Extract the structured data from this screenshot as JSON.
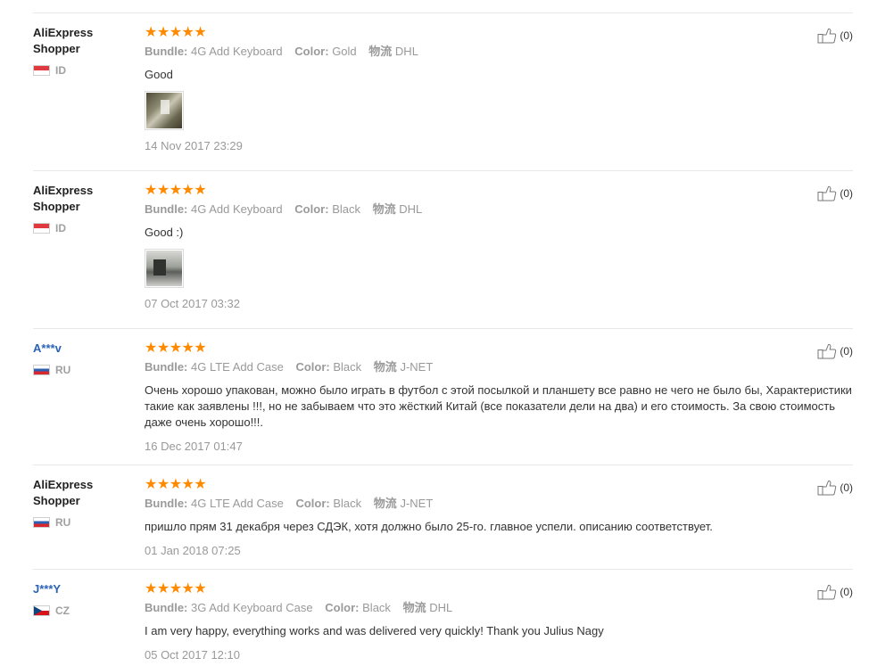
{
  "labels": {
    "bundle": "Bundle:",
    "color": "Color:",
    "shipping": "物流"
  },
  "reviews": [
    {
      "user": "AliExpress Shopper",
      "country": "ID",
      "stars": "★★★★★",
      "bundle": "4G Add Keyboard",
      "color": "Gold",
      "shipping": "DHL",
      "text": "Good",
      "date": "14 Nov 2017 23:29",
      "helpful": "(0)"
    },
    {
      "user": "AliExpress Shopper",
      "country": "ID",
      "stars": "★★★★★",
      "bundle": "4G Add Keyboard",
      "color": "Black",
      "shipping": "DHL",
      "text": "Good :)",
      "date": "07 Oct 2017 03:32",
      "helpful": "(0)"
    },
    {
      "user": "A***v",
      "country": "RU",
      "stars": "★★★★★",
      "bundle": "4G LTE Add Case",
      "color": "Black",
      "shipping": "J-NET",
      "text": "Очень хорошо упакован, можно было играть в футбол с этой посылкой и планшету все равно не чего не было бы, Характеристики такие как заявлены !!!, но не забываем что это жёсткий Китай (все показатели дели на два) и его стоимость. За свою стоимость даже очень хорошо!!!.",
      "date": "16 Dec 2017 01:47",
      "helpful": "(0)"
    },
    {
      "user": "AliExpress Shopper",
      "country": "RU",
      "stars": "★★★★★",
      "bundle": "4G LTE Add Case",
      "color": "Black",
      "shipping": "J-NET",
      "text": "пришло прям 31 декабря через СДЭК, хотя должно было 25-го. главное успели. описанию соответствует.",
      "date": "01 Jan 2018 07:25",
      "helpful": "(0)"
    },
    {
      "user": "J***Y",
      "country": "CZ",
      "stars": "★★★★★",
      "bundle": "3G Add Keyboard Case",
      "color": "Black",
      "shipping": "DHL",
      "text": "I am very happy, everything works and was delivered very quickly! Thank you Julius Nagy",
      "date": "05 Oct 2017 12:10",
      "helpful": "(0)"
    }
  ]
}
